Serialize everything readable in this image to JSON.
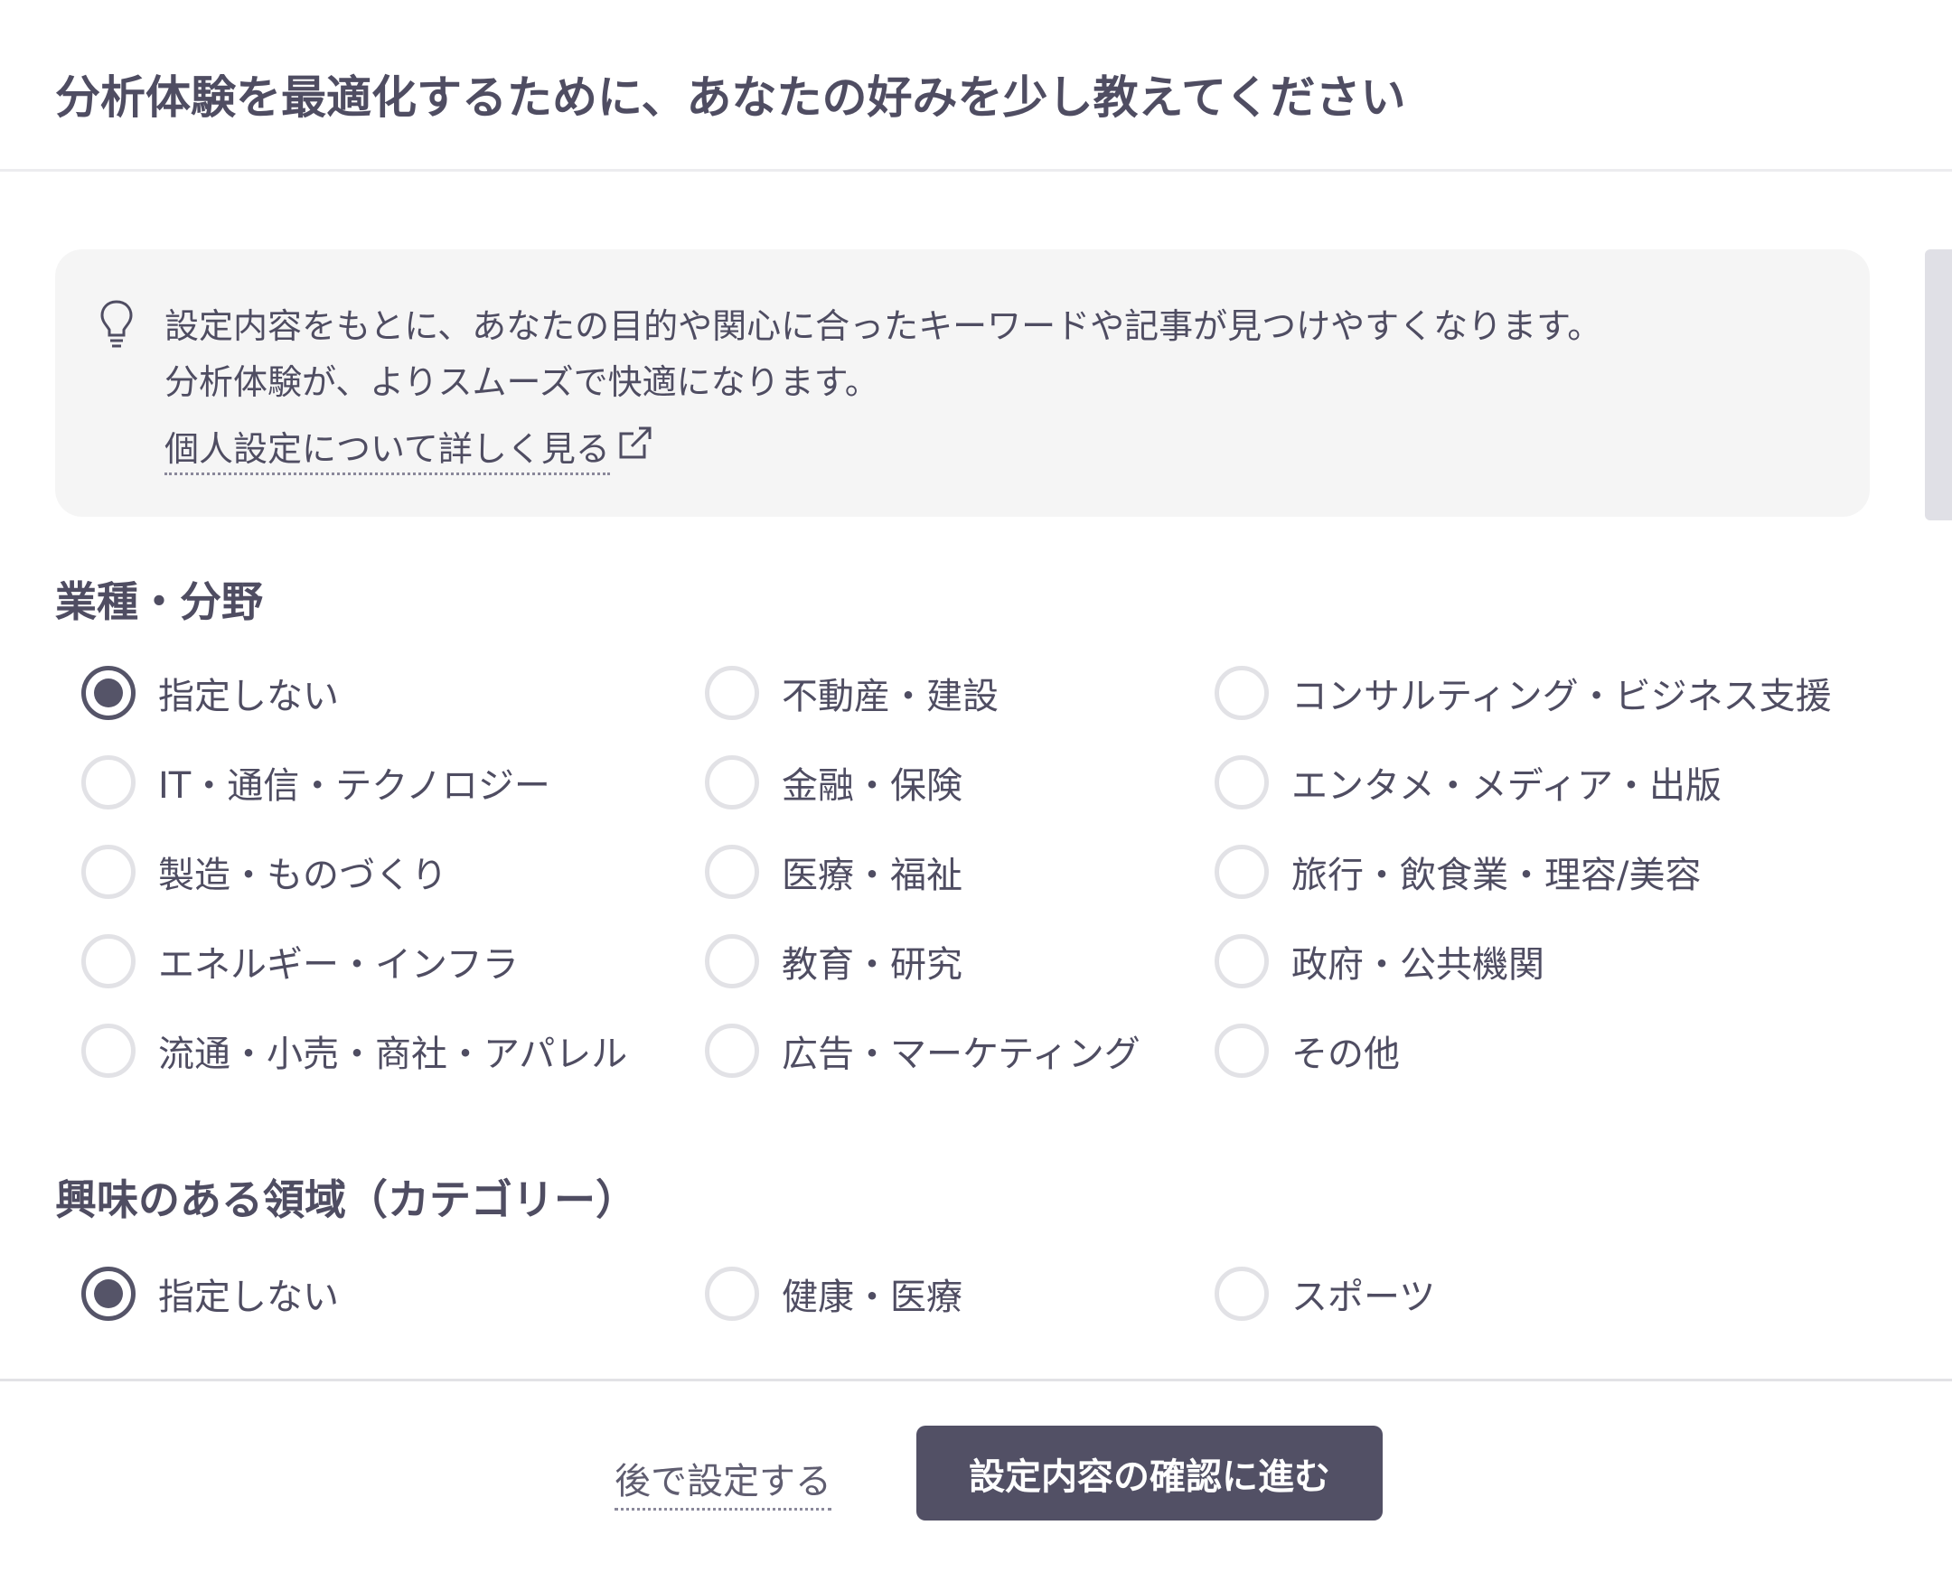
{
  "header": {
    "title": "分析体験を最適化するために、あなたの好みを少し教えてください"
  },
  "info": {
    "icon": "lightbulb-icon",
    "line1": "設定内容をもとに、あなたの目的や関心に合ったキーワードや記事が見つけやすくなります。",
    "line2": "分析体験が、よりスムーズで快適になります。",
    "link_label": "個人設定について詳しく見る",
    "link_icon": "external-link-icon"
  },
  "industry": {
    "title": "業種・分野",
    "options": [
      {
        "label": "指定しない",
        "checked": true
      },
      {
        "label": "不動産・建設",
        "checked": false
      },
      {
        "label": "コンサルティング・ビジネス支援",
        "checked": false
      },
      {
        "label": "IT・通信・テクノロジー",
        "checked": false
      },
      {
        "label": "金融・保険",
        "checked": false
      },
      {
        "label": "エンタメ・メディア・出版",
        "checked": false
      },
      {
        "label": "製造・ものづくり",
        "checked": false
      },
      {
        "label": "医療・福祉",
        "checked": false
      },
      {
        "label": "旅行・飲食業・理容/美容",
        "checked": false
      },
      {
        "label": "エネルギー・インフラ",
        "checked": false
      },
      {
        "label": "教育・研究",
        "checked": false
      },
      {
        "label": "政府・公共機関",
        "checked": false
      },
      {
        "label": "流通・小売・商社・アパレル",
        "checked": false
      },
      {
        "label": "広告・マーケティング",
        "checked": false
      },
      {
        "label": "その他",
        "checked": false
      }
    ]
  },
  "interests": {
    "title": "興味のある領域（カテゴリー）",
    "options": [
      {
        "label": "指定しない",
        "checked": true
      },
      {
        "label": "健康・医療",
        "checked": false
      },
      {
        "label": "スポーツ",
        "checked": false
      }
    ]
  },
  "footer": {
    "later_label": "後で設定する",
    "confirm_label": "設定内容の確認に進む"
  },
  "colors": {
    "primary": "#525065",
    "text": "#4f4d62",
    "info_bg": "#f5f5f5",
    "radio_border": "#e2e2e6"
  }
}
